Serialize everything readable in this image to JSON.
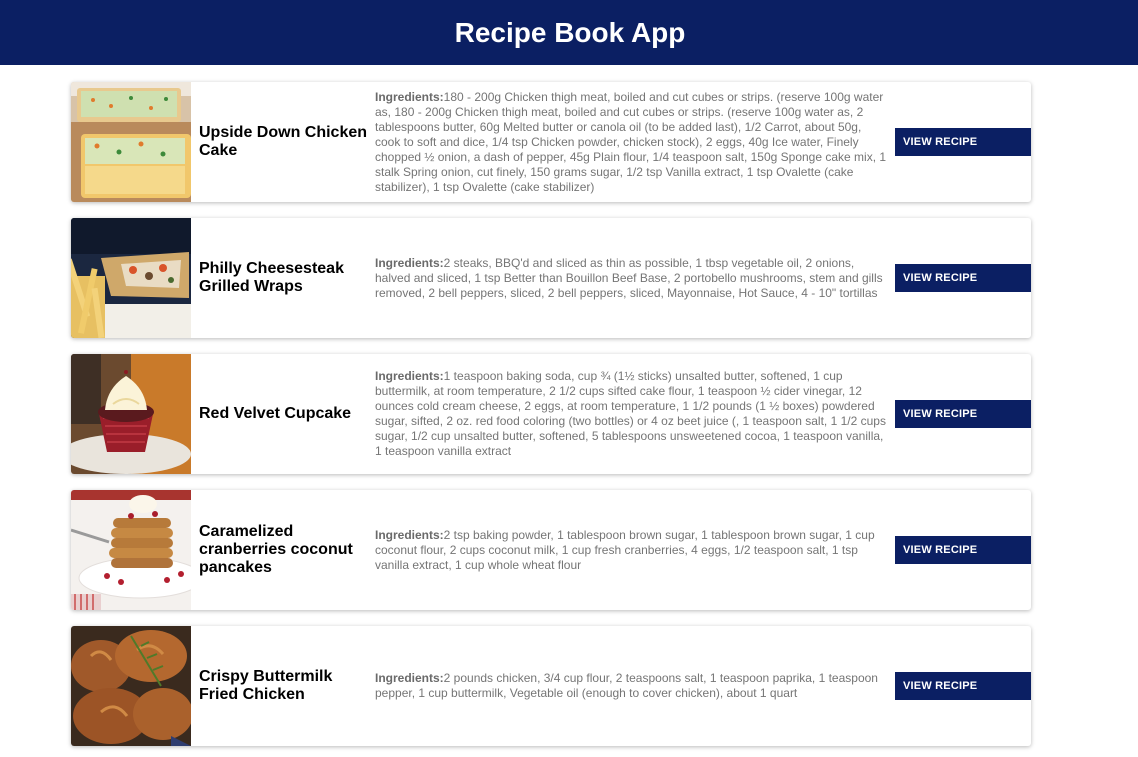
{
  "header": {
    "title": "Recipe Book App"
  },
  "ingredients_label": "Ingredients:",
  "colors": {
    "brand": "#0b1f63",
    "ingredients_text": "#757575"
  },
  "recipes": [
    {
      "name": "Upside Down Chicken Cake",
      "image": "chicken-cake-photo",
      "ingredients": "180 - 200g Chicken thigh meat, boiled and cut cubes or strips. (reserve 100g water as, 180 - 200g Chicken thigh meat, boiled and cut cubes or strips. (reserve 100g water as, 2 tablespoons butter, 60g Melted butter or canola oil (to be added last), 1/2 Carrot, about 50g, cook to soft and dice, 1/4 tsp Chicken powder, chicken stock), 2 eggs, 40g Ice water, Finely chopped ½ onion, a dash of pepper, 45g Plain flour, 1/4 teaspoon salt, 150g Sponge cake mix, 1 stalk Spring onion, cut finely, 150 grams sugar, 1/2 tsp Vanilla extract, 1 tsp Ovalette (cake stabilizer), 1 tsp Ovalette (cake stabilizer)",
      "button_label": "VIEW RECIPE"
    },
    {
      "name": "Philly Cheesesteak Grilled Wraps",
      "image": "cheesesteak-wrap-photo",
      "ingredients": "2 steaks, BBQ'd and sliced as thin as possible, 1 tbsp vegetable oil, 2 onions, halved and sliced, 1 tsp Better than Bouillon Beef Base, 2 portobello mushrooms, stem and gills removed, 2 bell peppers, sliced, 2 bell peppers, sliced, Mayonnaise, Hot Sauce, 4 - 10\" tortillas",
      "button_label": "VIEW RECIPE"
    },
    {
      "name": "Red Velvet Cupcake",
      "image": "red-velvet-cupcake-photo",
      "ingredients": "1 teaspoon baking soda, cup ¾ (1½ sticks) unsalted butter, softened, 1 cup buttermilk, at room temperature, 2 1/2 cups sifted cake flour, 1 teaspoon ½ cider vinegar, 12 ounces cold cream cheese, 2 eggs, at room temperature, 1 1/2 pounds (1 ½ boxes) powdered sugar, sifted, 2 oz. red food coloring (two bottles) or 4 oz beet juice (, 1 teaspoon salt, 1 1/2 cups sugar, 1/2 cup unsalted butter, softened, 5 tablespoons unsweetened cocoa, 1 teaspoon vanilla, 1 teaspoon vanilla extract",
      "button_label": "VIEW RECIPE"
    },
    {
      "name": "Caramelized cranberries coconut pancakes",
      "image": "cranberry-pancakes-photo",
      "ingredients": "2 tsp baking powder, 1 tablespoon brown sugar, 1 tablespoon brown sugar, 1 cup coconut flour, 2 cups coconut milk, 1 cup fresh cranberries, 4 eggs, 1/2 teaspoon salt, 1 tsp vanilla extract, 1 cup whole wheat flour",
      "button_label": "VIEW RECIPE"
    },
    {
      "name": "Crispy Buttermilk Fried Chicken",
      "image": "fried-chicken-photo",
      "ingredients": "2 pounds chicken, 3/4 cup flour, 2 teaspoons salt, 1 teaspoon paprika, 1 teaspoon pepper, 1 cup buttermilk, Vegetable oil (enough to cover chicken), about 1 quart",
      "button_label": "VIEW RECIPE"
    }
  ]
}
